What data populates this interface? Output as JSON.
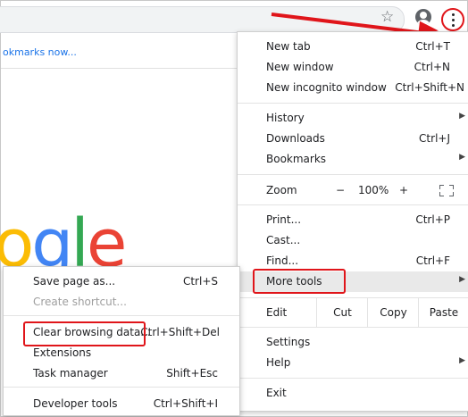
{
  "browser": {
    "bookmarks_bar_text": "okmarks now...",
    "logo_letters": [
      {
        "ch": "o",
        "color": "#fbbc05"
      },
      {
        "ch": "g",
        "color": "#4285f4"
      },
      {
        "ch": "l",
        "color": "#34a853"
      },
      {
        "ch": "e",
        "color": "#ea4335"
      }
    ],
    "toolbar_icons": [
      "star-icon",
      "profile-icon",
      "kebab-menu-icon"
    ]
  },
  "menu": {
    "new_tab": {
      "label": "New tab",
      "shortcut": "Ctrl+T"
    },
    "new_window": {
      "label": "New window",
      "shortcut": "Ctrl+N"
    },
    "new_incognito": {
      "label": "New incognito window",
      "shortcut": "Ctrl+Shift+N"
    },
    "history": {
      "label": "History"
    },
    "downloads": {
      "label": "Downloads",
      "shortcut": "Ctrl+J"
    },
    "bookmarks": {
      "label": "Bookmarks"
    },
    "zoom": {
      "label": "Zoom",
      "minus": "−",
      "value": "100%",
      "plus": "+"
    },
    "print": {
      "label": "Print...",
      "shortcut": "Ctrl+P"
    },
    "cast": {
      "label": "Cast..."
    },
    "find": {
      "label": "Find...",
      "shortcut": "Ctrl+F"
    },
    "more_tools": {
      "label": "More tools"
    },
    "edit": {
      "label": "Edit",
      "cut": "Cut",
      "copy": "Copy",
      "paste": "Paste"
    },
    "settings": {
      "label": "Settings"
    },
    "help": {
      "label": "Help"
    },
    "exit": {
      "label": "Exit"
    }
  },
  "submenu": {
    "save_page": {
      "label": "Save page as...",
      "shortcut": "Ctrl+S"
    },
    "create_shortcut": {
      "label": "Create shortcut..."
    },
    "clear_browsing": {
      "label": "Clear browsing data...",
      "shortcut": "Ctrl+Shift+Del"
    },
    "extensions": {
      "label": "Extensions"
    },
    "task_manager": {
      "label": "Task manager",
      "shortcut": "Shift+Esc"
    },
    "developer_tools": {
      "label": "Developer tools",
      "shortcut": "Ctrl+Shift+I"
    }
  },
  "colors": {
    "annotation_red": "#e0151a",
    "link_blue": "#1a73e8"
  }
}
